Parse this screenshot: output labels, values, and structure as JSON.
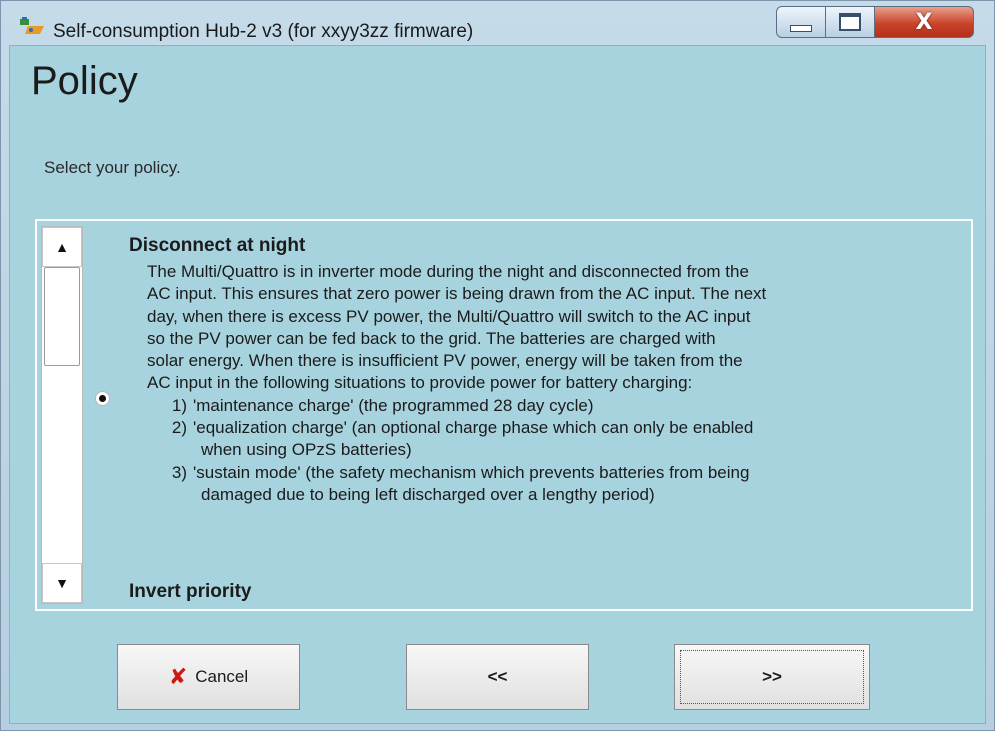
{
  "window": {
    "title": "Self-consumption Hub-2 v3 (for xxyy3zz firmware)",
    "controls": {
      "minimize_icon": "minimize-icon",
      "maximize_icon": "maximize-icon",
      "close_glyph": "X"
    }
  },
  "page": {
    "title": "Policy",
    "subtitle": "Select your policy."
  },
  "options": [
    {
      "title": "Disconnect at night",
      "selected": true,
      "description_lines": [
        "The Multi/Quattro is in inverter mode during the night and disconnected from the",
        "AC input. This ensures that zero power is being drawn from the AC input. The next",
        "day, when there is excess PV power, the Multi/Quattro will switch to the AC input",
        "so the PV power can be fed back to the grid. The batteries are charged with",
        "solar energy. When there is insufficient PV power, energy will be taken from the",
        "AC input in the following situations to provide power for battery charging:"
      ],
      "situations": [
        {
          "num": "1)",
          "lines": [
            "'maintenance charge'  (the programmed 28 day cycle)"
          ]
        },
        {
          "num": "2)",
          "lines": [
            "'equalization charge'  (an optional charge phase which can only be enabled",
            "when using OPzS batteries)"
          ]
        },
        {
          "num": "3)",
          "lines": [
            "'sustain mode'   (the safety mechanism which prevents batteries from being",
            "damaged due to being left discharged over a lengthy period)"
          ]
        }
      ]
    },
    {
      "title": "Invert priority",
      "selected": false
    }
  ],
  "scrollbar": {
    "up_arrow": "▲",
    "down_arrow": "▼"
  },
  "buttons": {
    "cancel": {
      "label": "Cancel",
      "icon": "x-icon",
      "icon_glyph": "✘"
    },
    "back": {
      "label": "<<"
    },
    "next": {
      "label": ">>",
      "focused": true
    }
  },
  "colors": {
    "client_bg": "#a7d3de",
    "cancel_icon": "#cc1a12"
  }
}
